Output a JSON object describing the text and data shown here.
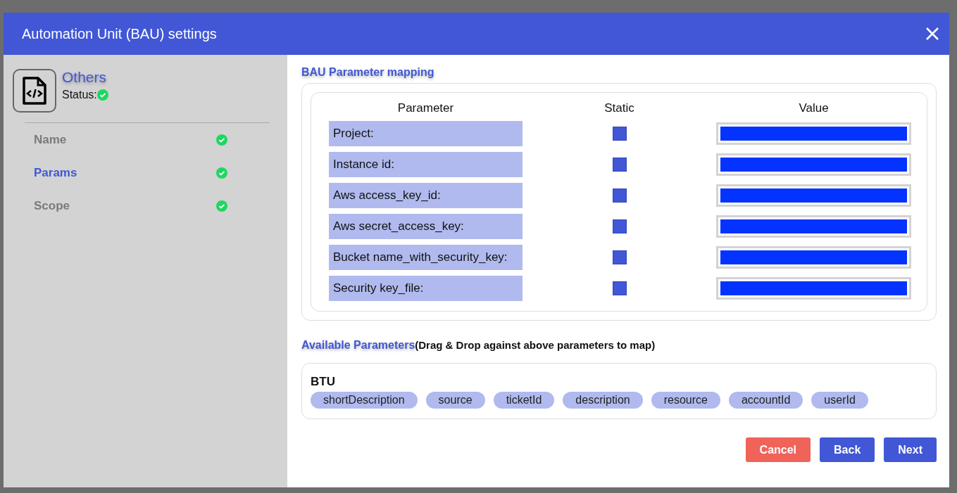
{
  "dialog": {
    "title": "Automation Unit (BAU) settings"
  },
  "sidebar": {
    "heading": "Others",
    "status_label": "Status:",
    "status_done": true,
    "items": [
      {
        "label": "Name",
        "selected": false,
        "done": true
      },
      {
        "label": "Params",
        "selected": true,
        "done": true
      },
      {
        "label": "Scope",
        "selected": false,
        "done": true
      }
    ]
  },
  "mapping": {
    "title": "BAU Parameter mapping",
    "columns": [
      "Parameter",
      "Static",
      "Value"
    ],
    "rows": [
      {
        "parameter": "Project:",
        "static": false
      },
      {
        "parameter": "Instance id:",
        "static": false
      },
      {
        "parameter": "Aws access_key_id:",
        "static": false
      },
      {
        "parameter": "Aws secret_access_key:",
        "static": false
      },
      {
        "parameter": "Bucket name_with_security_key:",
        "static": false
      },
      {
        "parameter": "Security key_file:",
        "static": false
      }
    ]
  },
  "available": {
    "title": "Available Parameters",
    "hint": "(Drag & Drop against above parameters to map)",
    "group": "BTU",
    "chips": [
      "shortDescription",
      "source",
      "ticketId",
      "description",
      "resource",
      "accountId",
      "userId"
    ]
  },
  "buttons": [
    {
      "label": "Cancel",
      "kind": "danger"
    },
    {
      "label": "Back",
      "kind": "primary"
    },
    {
      "label": "Next",
      "kind": "primary"
    }
  ]
}
